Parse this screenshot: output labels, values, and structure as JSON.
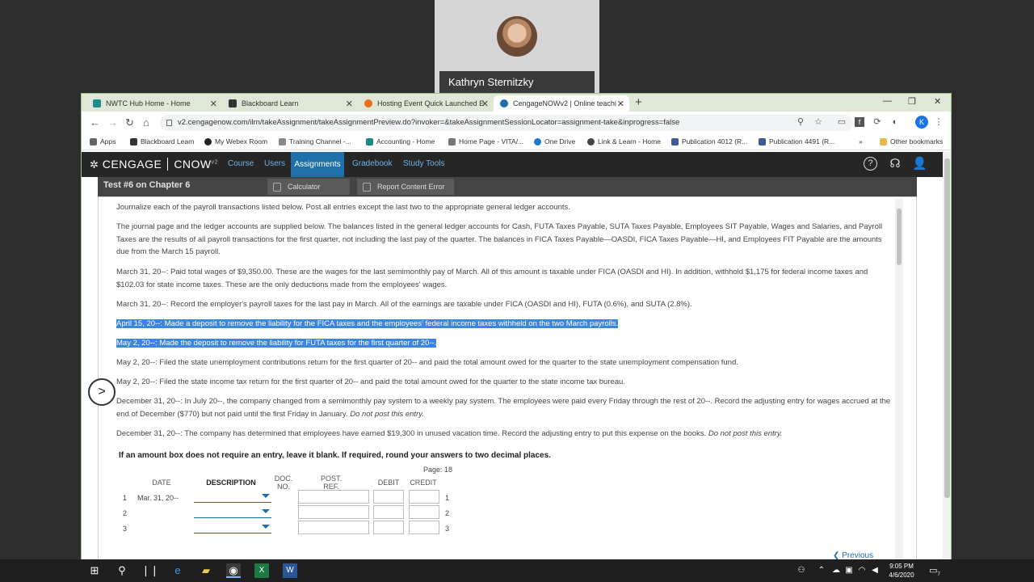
{
  "video": {
    "participant_name": "Kathryn Sternitzky"
  },
  "browser": {
    "tabs": [
      {
        "label": "NWTC Hub Home - Home",
        "color": "#1b8a8a"
      },
      {
        "label": "Blackboard Learn",
        "color": "#333333"
      },
      {
        "label": "Hosting Event Quick Launched E",
        "color": "#e8701a"
      },
      {
        "label": "CengageNOWv2 | Online teachi",
        "color": "#1f6fa8"
      }
    ],
    "url": "v2.cengagenow.com/ilrn/takeAssignment/takeAssignmentPreview.do?invoker=&takeAssignmentSessionLocator=assignment-take&inprogress=false",
    "bookmarks": [
      {
        "label": "Apps"
      },
      {
        "label": "Blackboard Learn"
      },
      {
        "label": "My Webex Room"
      },
      {
        "label": "Training Channel -..."
      },
      {
        "label": "Accounting - Home"
      },
      {
        "label": "Home Page - VITA/..."
      },
      {
        "label": "One Drive"
      },
      {
        "label": "Link & Learn - Home"
      },
      {
        "label": "Publication 4012 (R..."
      },
      {
        "label": "Publication 4491 (R..."
      },
      {
        "label": "Other bookmarks"
      }
    ]
  },
  "cengage": {
    "logo": "CENGAGE",
    "product": "CNOW",
    "product_version": "v2",
    "nav": [
      "Course",
      "Users",
      "Assignments",
      "Gradebook",
      "Study Tools"
    ],
    "active_nav": "Assignments"
  },
  "test": {
    "title": "Test #6 on Chapter 6",
    "calculator_label": "Calculator",
    "report_label": "Report Content Error"
  },
  "problem": {
    "paragraphs": [
      {
        "text": "Journalize each of the payroll transactions listed below. Post all entries except the last two to the appropriate general ledger accounts.",
        "highlighted": false
      },
      {
        "text": "The journal page and the ledger accounts are supplied below. The balances listed in the general ledger accounts for Cash, FUTA Taxes Payable, SUTA Taxes Payable, Employees SIT Payable, Wages and Salaries, and Payroll Taxes are the results of all payroll transactions for the first quarter, not including the last pay of the quarter. The balances in FICA Taxes Payable—OASDI, FICA Taxes Payable—HI, and Employees FIT Payable are the amounts due from the March 15 payroll.",
        "highlighted": false
      },
      {
        "text": "March 31, 20--: Paid total wages of $9,350.00. These are the wages for the last semimonthly pay of March. All of this amount is taxable under FICA (OASDI and HI). In addition, withhold $1,175 for federal income taxes and $102.03 for state income taxes. These are the only deductions made from the employees' wages.",
        "highlighted": false
      },
      {
        "text": "March 31, 20--: Record the employer's payroll taxes for the last pay in March. All of the earnings are taxable under FICA (OASDI and HI), FUTA (0.6%), and SUTA (2.8%).",
        "highlighted": false
      },
      {
        "text": "April 15, 20--: Made a deposit to remove the liability for the FICA taxes and the employees' federal income taxes withheld on the two March payrolls.",
        "highlighted": true
      },
      {
        "text": "May 2, 20--: Made the deposit to remove the liability for FUTA taxes for the first quarter of 20--.",
        "highlighted": true
      },
      {
        "text": "May 2, 20--: Filed the state unemployment contributions return for the first quarter of 20-- and paid the total amount owed for the quarter to the state unemployment compensation fund.",
        "highlighted": false
      },
      {
        "text": "May 2, 20--: Filed the state income tax return for the first quarter of 20-- and paid the total amount owed for the quarter to the state income tax bureau.",
        "highlighted": false
      },
      {
        "text": "December 31, 20--: In July 20--, the company changed from a semimonthly pay system to a weekly pay system. The employees were paid every Friday through the rest of 20--. Record the adjusting entry for wages accrued at the end of December ($770) but not paid until the first Friday in January.",
        "italic_suffix": "Do not post this entry.",
        "highlighted": false
      },
      {
        "text": "December 31, 20--: The company has determined that employees have earned $19,300 in unused vacation time. Record the adjusting entry to put this expense on the books.",
        "italic_suffix": "Do not post this entry.",
        "highlighted": false
      }
    ],
    "instructions": "If an amount box does not require an entry, leave it blank. If required, round your answers to two decimal places.",
    "page_label": "Page: 18"
  },
  "journal": {
    "headers": {
      "date": "DATE",
      "description": "DESCRIPTION",
      "doc_no": "DOC. NO.",
      "post_ref": "POST. REF.",
      "debit": "DEBIT",
      "credit": "CREDIT"
    },
    "rows": [
      {
        "num": "1",
        "date": "Mar. 31, 20--"
      },
      {
        "num": "2",
        "date": ""
      },
      {
        "num": "3",
        "date": ""
      }
    ]
  },
  "footer": {
    "previous_label": "Previous"
  },
  "taskbar": {
    "time": "9:05 PM",
    "date": "4/6/2020",
    "notification_count": "7"
  }
}
